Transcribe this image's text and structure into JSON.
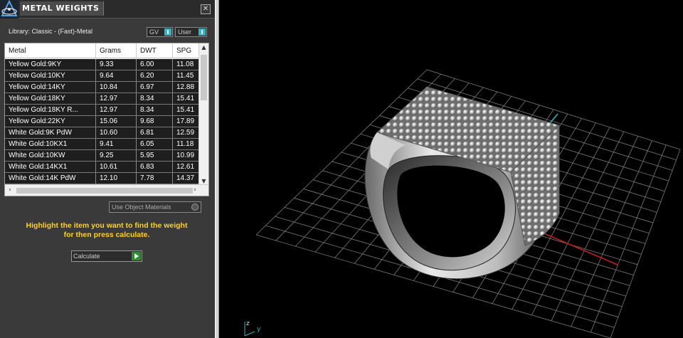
{
  "panel": {
    "title": "METAL WEIGHTS",
    "close_glyph": "✕",
    "library_label": "Library: Classic - (Fast)-Metal",
    "toggle_gv": "GV",
    "toggle_user": "User",
    "use_object_materials": "Use Object Materials",
    "hint_line1": "Highlight the item you want to find the weight",
    "hint_line2": "for then press calculate.",
    "calculate_label": "Calculate"
  },
  "table": {
    "columns": [
      "Metal",
      "Grams",
      "DWT",
      "SPG"
    ],
    "rows": [
      [
        "Yellow Gold:9KY",
        "9.33",
        "6.00",
        "11.08"
      ],
      [
        "Yellow Gold:10KY",
        "9.64",
        "6.20",
        "11.45"
      ],
      [
        "Yellow Gold:14KY",
        "10.84",
        "6.97",
        "12.88"
      ],
      [
        "Yellow Gold:18KY",
        "12.97",
        "8.34",
        "15.41"
      ],
      [
        "Yellow Gold:18KY R...",
        "12.97",
        "8.34",
        "15.41"
      ],
      [
        "Yellow Gold:22KY",
        "15.06",
        "9.68",
        "17.89"
      ],
      [
        "White Gold:9K PdW",
        "10.60",
        "6.81",
        "12.59"
      ],
      [
        "White Gold:10KX1",
        "9.41",
        "6.05",
        "11.18"
      ],
      [
        "White Gold:10KW",
        "9.25",
        "5.95",
        "10.99"
      ],
      [
        "White Gold:14KX1",
        "10.61",
        "6.83",
        "12.61"
      ],
      [
        "White Gold:14K PdW",
        "12.10",
        "7.78",
        "14.37"
      ]
    ]
  },
  "viewport": {
    "axis_z": "z",
    "axis_y": "y"
  },
  "colors": {
    "hint": "#ffd21f",
    "selection_row": "#1e1e1e",
    "toggle_accent": "#3ab0c0",
    "go_button": "#2f8c2f",
    "axis_x": "#c02020",
    "axis_y": "#3ab0c0"
  },
  "icons": {
    "logo": "app-logo-icon",
    "close": "close-icon",
    "calculate_go": "play-arrow-icon"
  }
}
